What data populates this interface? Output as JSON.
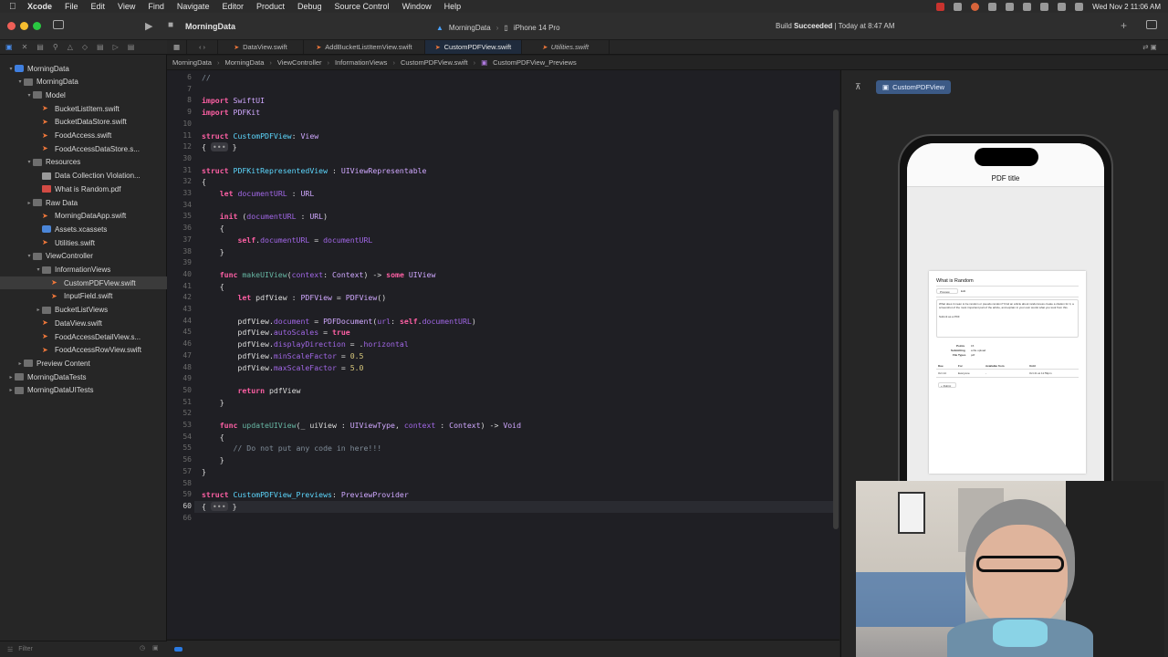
{
  "menubar": {
    "app_name": "Xcode",
    "items": [
      "File",
      "Edit",
      "View",
      "Find",
      "Navigate",
      "Editor",
      "Product",
      "Debug",
      "Source Control",
      "Window",
      "Help"
    ],
    "clock": "Wed Nov 2  11:06 AM"
  },
  "toolbar": {
    "project_name": "MorningData",
    "scheme_name": "MorningData",
    "device": "iPhone 14 Pro",
    "build_prefix": "Build",
    "build_result": "Succeeded",
    "build_time": "| Today at 8:47 AM"
  },
  "tabs": [
    {
      "label": "DataView.swift"
    },
    {
      "label": "AddBucketListItemView.swift"
    },
    {
      "label": "CustomPDFView.swift"
    },
    {
      "label": "Utilities.swift"
    }
  ],
  "breadcrumbs": [
    "MorningData",
    "MorningData",
    "ViewController",
    "InformationViews",
    "CustomPDFView.swift",
    "CustomPDFView_Previews"
  ],
  "navigator": {
    "filter_placeholder": "Filter",
    "rows": [
      {
        "label": "MorningData",
        "icon": "project-icon"
      },
      {
        "label": "MorningData",
        "icon": "folder-icon"
      },
      {
        "label": "Model",
        "icon": "folder-icon"
      },
      {
        "label": "BucketListItem.swift",
        "icon": "swift-file-icon"
      },
      {
        "label": "BucketDataStore.swift",
        "icon": "swift-file-icon"
      },
      {
        "label": "FoodAccess.swift",
        "icon": "swift-file-icon"
      },
      {
        "label": "FoodAccessDataStore.s...",
        "icon": "swift-file-icon"
      },
      {
        "label": "Resources",
        "icon": "folder-icon"
      },
      {
        "label": "Data Collection Violation...",
        "icon": "document-icon"
      },
      {
        "label": "What is Random.pdf",
        "icon": "pdf-file-icon"
      },
      {
        "label": "Raw Data",
        "icon": "folder-icon"
      },
      {
        "label": "MorningDataApp.swift",
        "icon": "swift-file-icon"
      },
      {
        "label": "Assets.xcassets",
        "icon": "assets-icon"
      },
      {
        "label": "Utilities.swift",
        "icon": "swift-file-icon"
      },
      {
        "label": "ViewController",
        "icon": "folder-icon"
      },
      {
        "label": "InformationViews",
        "icon": "folder-icon"
      },
      {
        "label": "CustomPDFView.swift",
        "icon": "swift-file-icon"
      },
      {
        "label": "InputField.swift",
        "icon": "swift-file-icon"
      },
      {
        "label": "BucketListViews",
        "icon": "folder-icon"
      },
      {
        "label": "DataView.swift",
        "icon": "swift-file-icon"
      },
      {
        "label": "FoodAccessDetailView.s...",
        "icon": "swift-file-icon"
      },
      {
        "label": "FoodAccessRowView.swift",
        "icon": "swift-file-icon"
      },
      {
        "label": "Preview Content",
        "icon": "folder-icon"
      },
      {
        "label": "MorningDataTests",
        "icon": "folder-icon"
      },
      {
        "label": "MorningDataUITests",
        "icon": "folder-icon"
      }
    ]
  },
  "code": {
    "line_numbers": [
      "6",
      "7",
      "8",
      "9",
      "10",
      "11",
      "12",
      "30",
      "31",
      "32",
      "33",
      "34",
      "35",
      "36",
      "37",
      "38",
      "39",
      "40",
      "41",
      "42",
      "43",
      "44",
      "45",
      "46",
      "47",
      "48",
      "49",
      "50",
      "51",
      "52",
      "53",
      "54",
      "55",
      "56",
      "57",
      "58",
      "59",
      "60",
      "66"
    ],
    "lines": [
      "//",
      "",
      "import SwiftUI",
      "import PDFKit",
      "",
      "struct CustomPDFView: View",
      "{ ••• }",
      "",
      "struct PDFKitRepresentedView : UIViewRepresentable",
      "{",
      "    let documentURL : URL",
      "",
      "    init (documentURL : URL)",
      "    {",
      "        self.documentURL = documentURL",
      "    }",
      "",
      "    func makeUIView(context: Context) -> some UIView",
      "    {",
      "        let pdfView : PDFView = PDFView()",
      "",
      "        pdfView.document = PDFDocument(url: self.documentURL)",
      "        pdfView.autoScales = true",
      "        pdfView.displayDirection = .horizontal",
      "        pdfView.minScaleFactor = 0.5",
      "        pdfView.maxScaleFactor = 5.0",
      "",
      "        return pdfView",
      "    }",
      "",
      "    func updateUIView(_ uiView : UIViewType, context : Context) -> Void",
      "    {",
      "       // Do not put any code in here!!!",
      "    }",
      "}",
      "",
      "struct CustomPDFView_Previews: PreviewProvider",
      "{ ••• }",
      ""
    ]
  },
  "canvas": {
    "preview_label": "CustomPDFView",
    "phone_title": "PDF title",
    "pdf": {
      "heading": "What is Random",
      "toolbar_a": "Preview",
      "toolbar_b": "Edit",
      "body": "What does it mean to be random or pseudo random? Find an article about randomness create a citation for it, a screenshot of the most important part of the article, and explain in your own words what you took from this.",
      "submit_note": "Submit as a PDF",
      "meta": [
        {
          "k": "Points",
          "v": "15"
        },
        {
          "k": "Submitting",
          "v": "a file upload"
        },
        {
          "k": "File Types",
          "v": "pdf"
        }
      ],
      "table_headers": [
        "Due",
        "For",
        "Available from",
        "Until"
      ],
      "table_row": [
        "Oct 14",
        "Everyone",
        "-",
        "Oct 21 at 11:59pm"
      ],
      "rubric": "+ Rubric"
    }
  }
}
